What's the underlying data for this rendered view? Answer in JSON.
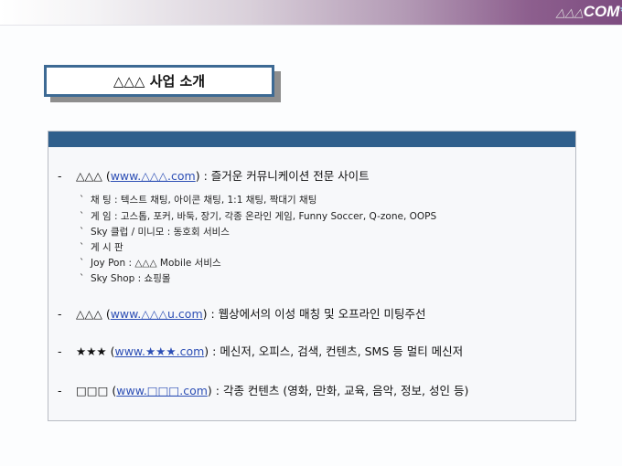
{
  "header": {
    "brand_symbols": "△△△",
    "brand_text": "COM",
    "brand_star": "*"
  },
  "title": "△△△ 사업 소개",
  "items": [
    {
      "bullet": "-",
      "name": "△△△",
      "link": "www.△△△.com",
      "desc": ") : 즐거운 커뮤니케이션 전문 사이트",
      "subitems": [
        "채 팅  :  텍스트 채팅, 아이콘 채팅, 1:1 채팅, 짝대기 채팅",
        "게 임  :  고스톱, 포커, 바둑, 장기, 각종 온라인 게임, Funny Soccer, Q-zone, OOPS",
        "Sky 클럽 / 미니모  :  동호회 서비스",
        "게 시 판",
        "Joy Pon  :  △△△ Mobile 서비스",
        "Sky Shop  :  쇼핑몰"
      ]
    },
    {
      "bullet": "-",
      "name": "△△△",
      "link": "www.△△△u.com",
      "desc": ") : 웹상에서의 이성 매칭 및 오프라인 미팅주선"
    },
    {
      "bullet": "-",
      "name": "★★★",
      "link": "www.★★★.com",
      "desc": ") : 메신저, 오피스, 검색, 컨텐츠, SMS 등 멀티 메신저"
    },
    {
      "bullet": "-",
      "name": "□□□",
      "link": "www.□□□.com",
      "desc": ") : 각종 컨텐츠 (영화, 만화, 교육, 음악, 정보, 성인 등)"
    }
  ],
  "sub_marker": "`",
  "colors": {
    "accent": "#2f5f8c",
    "link": "#2d4fb5",
    "header_end": "#7d4c80"
  }
}
